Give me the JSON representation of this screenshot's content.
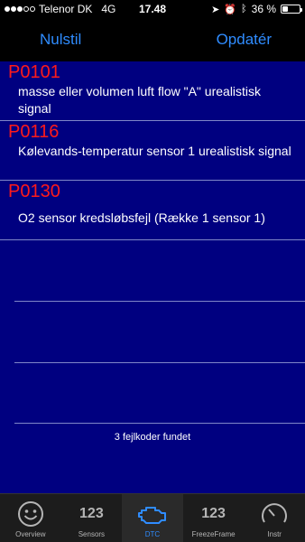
{
  "status": {
    "carrier": "Telenor DK",
    "network": "4G",
    "time": "17.48",
    "battery": "36 %",
    "battery_level": 0.36
  },
  "nav": {
    "left_button": "Nulstil",
    "right_button": "Opdatér"
  },
  "dtcs": [
    {
      "code": "P0101",
      "description": "masse eller volumen luft flow \"A\" urealistisk signal"
    },
    {
      "code": "P0116",
      "description": "Kølevands-temperatur sensor 1 urealistisk signal"
    },
    {
      "code": "P0130",
      "description": "O2 sensor kredsløbsfejl (Række 1 sensor 1)"
    }
  ],
  "footer_text": "3 fejlkoder fundet",
  "tabs": [
    {
      "label": "Overview",
      "icon": "smiley-icon"
    },
    {
      "label": "Sensors",
      "icon_text": "123"
    },
    {
      "label": "DTC",
      "icon": "engine-icon"
    },
    {
      "label": "FreezeFrame",
      "icon_text": "123"
    },
    {
      "label": "Instr",
      "icon": "gauge-icon"
    }
  ],
  "colors": {
    "accent": "#2f8cff",
    "content_bg": "#000080",
    "code_red": "#ff1a1a"
  }
}
